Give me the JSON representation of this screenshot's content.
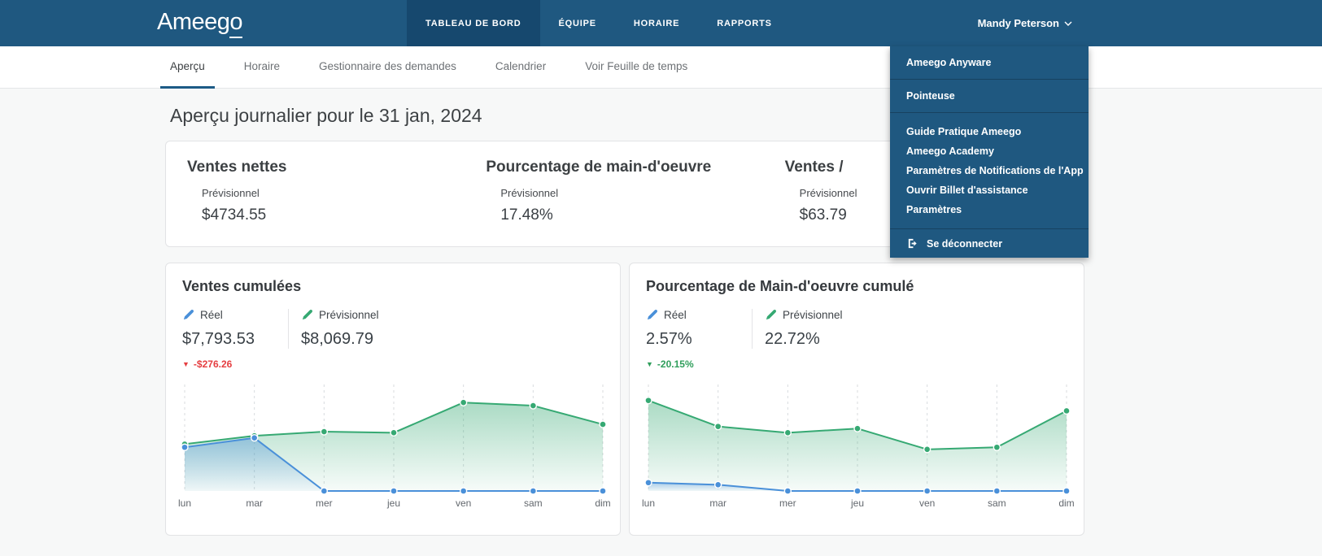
{
  "navbar": {
    "logo_prefix": "Ameeg",
    "logo_suffix": "o",
    "tabs": [
      {
        "label": "TABLEAU DE BORD",
        "active": true
      },
      {
        "label": "ÉQUIPE",
        "active": false
      },
      {
        "label": "HORAIRE",
        "active": false
      },
      {
        "label": "RAPPORTS",
        "active": false
      }
    ],
    "user_name": "Mandy Peterson"
  },
  "subnav": {
    "items": [
      {
        "label": "Aperçu",
        "active": true
      },
      {
        "label": "Horaire",
        "active": false
      },
      {
        "label": "Gestionnaire des demandes",
        "active": false
      },
      {
        "label": "Calendrier",
        "active": false
      },
      {
        "label": "Voir Feuille de temps",
        "active": false
      }
    ]
  },
  "user_menu": {
    "item_anyware": "Ameego Anyware",
    "item_pointeuse": "Pointeuse",
    "group_items": [
      "Guide Pratique Ameego",
      "Ameego Academy",
      "Paramètres de Notifications de l'App",
      "Ouvrir Billet d'assistance",
      "Paramètres"
    ],
    "logout_label": "Se déconnecter"
  },
  "page": {
    "title": "Aperçu journalier pour le 31 jan, 2024"
  },
  "summary": {
    "metrics": [
      {
        "heading": "Ventes nettes",
        "label": "Prévisionnel",
        "value": "$4734.55"
      },
      {
        "heading": "Pourcentage de main-d'oeuvre",
        "label": "Prévisionnel",
        "value": "17.48%"
      },
      {
        "heading": "Ventes /",
        "label": "Prévisionnel",
        "value": "$63.79"
      }
    ]
  },
  "cards": [
    {
      "title": "Ventes cumulées",
      "legend": [
        {
          "label": "Réel",
          "value": "$7,793.53"
        },
        {
          "label": "Prévisionnel",
          "value": "$8,069.79"
        }
      ],
      "delta": {
        "arrow": "▼",
        "text": "-$276.26",
        "color": "#e53e41"
      }
    },
    {
      "title": "Pourcentage de Main-d'oeuvre cumulé",
      "legend": [
        {
          "label": "Réel",
          "value": "2.57%"
        },
        {
          "label": "Prévisionnel",
          "value": "22.72%"
        }
      ],
      "delta": {
        "arrow": "▼",
        "text": "-20.15%",
        "color": "#2f9e5b"
      }
    }
  ],
  "chart_data": [
    {
      "type": "area",
      "title": "Ventes cumulées",
      "categories": [
        "lun",
        "mar",
        "mer",
        "jeu",
        "ven",
        "sam",
        "dim"
      ],
      "series": [
        {
          "name": "Réel",
          "color": "#4a90d9",
          "values": [
            42,
            51,
            0,
            0,
            0,
            0,
            0
          ]
        },
        {
          "name": "Prévisionnel",
          "color": "#36a973",
          "values": [
            45,
            53,
            57,
            56,
            85,
            82,
            64
          ]
        }
      ],
      "ylim": [
        0,
        100
      ],
      "y_axis": "hidden",
      "grid": "vertical-dashed",
      "note": "y-axis unlabeled; values estimated as percent of plot height"
    },
    {
      "type": "area",
      "title": "Pourcentage de Main-d'oeuvre cumulé",
      "categories": [
        "lun",
        "mar",
        "mer",
        "jeu",
        "ven",
        "sam",
        "dim"
      ],
      "series": [
        {
          "name": "Réel",
          "color": "#4a90d9",
          "values": [
            8,
            6,
            0,
            0,
            0,
            0,
            0
          ]
        },
        {
          "name": "Prévisionnel",
          "color": "#36a973",
          "values": [
            87,
            62,
            56,
            60,
            40,
            42,
            77
          ]
        }
      ],
      "ylim": [
        0,
        100
      ],
      "y_axis": "hidden",
      "grid": "vertical-dashed",
      "note": "y-axis unlabeled; values estimated as percent of plot height"
    }
  ],
  "colors": {
    "navbar": "#1f5880",
    "navbar_active_tab": "#16486e",
    "accent": "#1d5b86",
    "series_blue": "#4a90d9",
    "series_green": "#36a973",
    "delta_red": "#e53e41",
    "delta_green": "#2f9e5b"
  }
}
